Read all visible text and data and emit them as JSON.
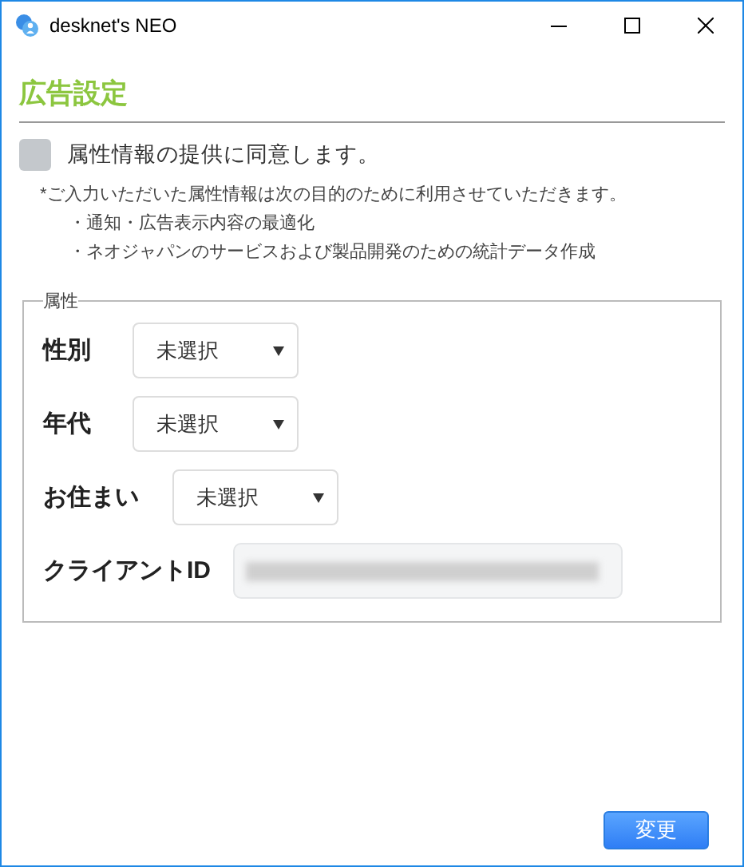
{
  "window": {
    "title": "desknet's NEO"
  },
  "heading": "広告設定",
  "consent": {
    "label": "属性情報の提供に同意します。",
    "checked": false
  },
  "notes": [
    "*ご入力いただいた属性情報は次の目的のために利用させていただきます。",
    "・通知・広告表示内容の最適化",
    "・ネオジャパンのサービスおよび製品開発のための統計データ作成"
  ],
  "attributes": {
    "legend": "属性",
    "fields": [
      {
        "kind": "select",
        "label": "性別",
        "value": "未選択"
      },
      {
        "kind": "select",
        "label": "年代",
        "value": "未選択"
      },
      {
        "kind": "select",
        "label": "お住まい",
        "value": "未選択"
      },
      {
        "kind": "blurred",
        "label": "クライアントID"
      }
    ]
  },
  "buttons": [
    "変更"
  ]
}
